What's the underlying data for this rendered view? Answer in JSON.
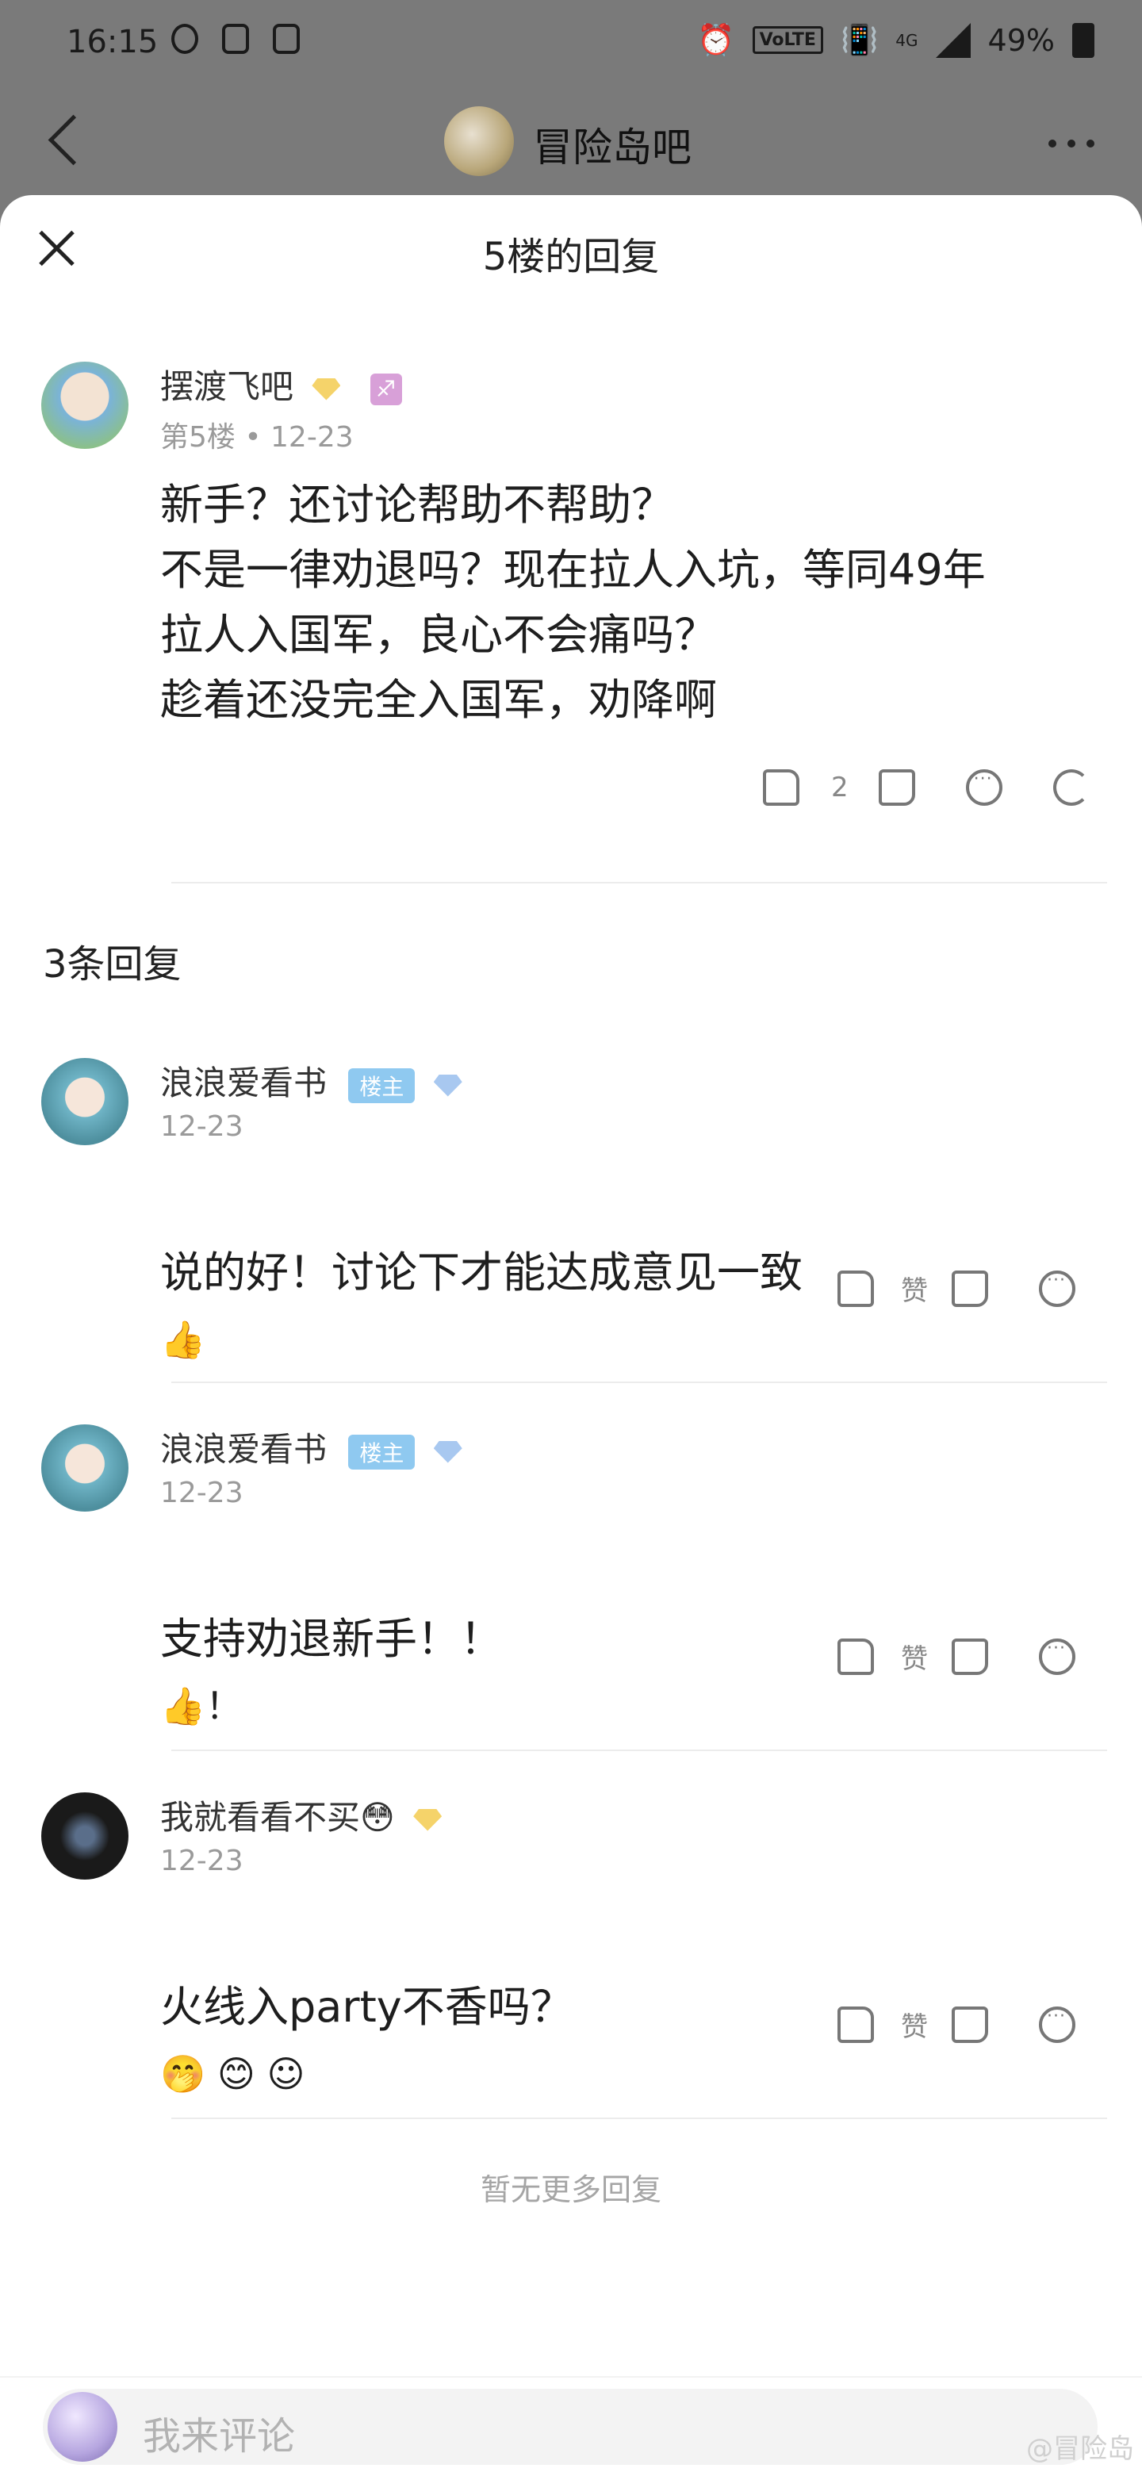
{
  "status": {
    "time": "16:15",
    "volte": "VoLTE",
    "network": "4G",
    "battery": "49%"
  },
  "nav": {
    "title": "冒险岛吧"
  },
  "sheet": {
    "title": "5楼的回复"
  },
  "post": {
    "user": "摆渡飞吧",
    "level": "12",
    "zodiac": "♐",
    "meta": "第5楼 • 12-23",
    "content": "新手？还讨论帮助不帮助？\n不是一律劝退吗？现在拉人入坑，等同49年\n拉人入国军，良心不会痛吗？\n趁着还没完全入国军，劝降啊",
    "likes": "2"
  },
  "reply_count": "3条回复",
  "replies": [
    {
      "user": "浪浪爱看书",
      "badge": "楼主",
      "level": "9",
      "time": "12-23",
      "content": "说的好！讨论下才能达成意见一致",
      "emoji": "👍",
      "like_label": "赞"
    },
    {
      "user": "浪浪爱看书",
      "badge": "楼主",
      "level": "9",
      "time": "12-23",
      "content": "支持劝退新手！！",
      "emoji": "👍！",
      "like_label": "赞"
    },
    {
      "user": "我就看看不买😳",
      "badge": "",
      "level": "11",
      "time": "12-23",
      "content": "火线入party不香吗？",
      "emoji": "🤭 😊 ☺",
      "like_label": "赞"
    }
  ],
  "no_more": "暂无更多回复",
  "comment": {
    "placeholder": "我来评论"
  },
  "watermark": "@冒险岛"
}
